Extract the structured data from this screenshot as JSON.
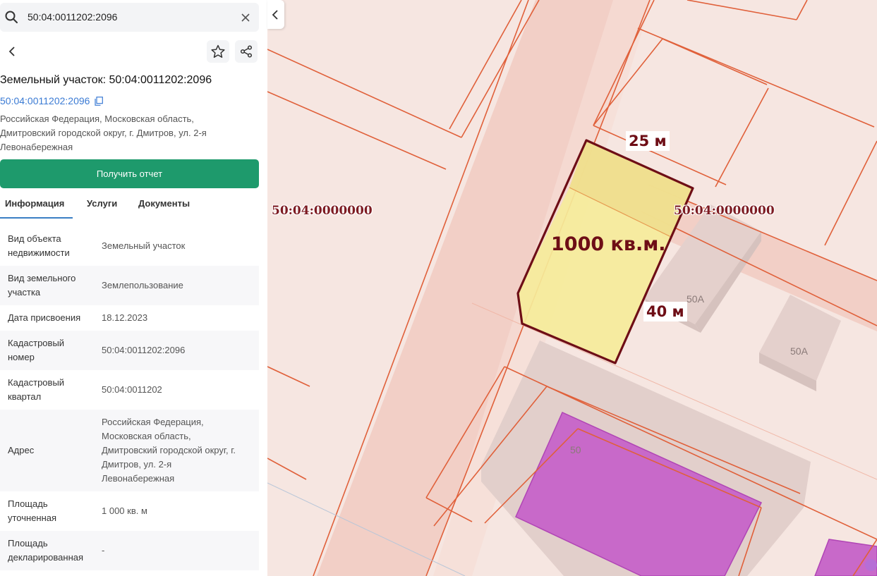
{
  "search": {
    "value": "50:04:0011202:2096"
  },
  "object": {
    "title": "Земельный участок: 50:04:0011202:2096",
    "cadastral_link": "50:04:0011202:2096",
    "address_lines": [
      "Российская Федерация, Московская область,",
      "Дмитровский городской округ, г. Дмитров, ул. 2-я",
      "Левонабережная"
    ]
  },
  "report_button": "Получить отчет",
  "tabs": [
    {
      "label": "Информация",
      "active": true
    },
    {
      "label": "Услуги",
      "active": false
    },
    {
      "label": "Документы",
      "active": false
    }
  ],
  "info_rows": [
    {
      "label_lines": [
        "Вид объекта",
        "недвижимости"
      ],
      "value_lines": [
        "Земельный участок"
      ]
    },
    {
      "label_lines": [
        "Вид земельного",
        "участка"
      ],
      "value_lines": [
        "Землепользование"
      ]
    },
    {
      "label_lines": [
        "Дата присвоения"
      ],
      "value_lines": [
        "18.12.2023"
      ]
    },
    {
      "label_lines": [
        "Кадастровый",
        "номер"
      ],
      "value_lines": [
        "50:04:0011202:2096"
      ]
    },
    {
      "label_lines": [
        "Кадастровый",
        "квартал"
      ],
      "value_lines": [
        "50:04:0011202"
      ]
    },
    {
      "label_lines": [
        "Адрес"
      ],
      "value_lines": [
        "Российская Федерация,",
        "Московская область,",
        "Дмитровский городской округ, г.",
        "Дмитров, ул. 2-я",
        "Левонабережная"
      ]
    },
    {
      "label_lines": [
        "Площадь",
        "уточненная"
      ],
      "value_lines": [
        "1 000 кв. м"
      ]
    },
    {
      "label_lines": [
        "Площадь",
        "декларированная"
      ],
      "value_lines": [
        "-"
      ]
    }
  ],
  "map": {
    "quarter_label_left": "50:04:0000000",
    "quarter_label_right": "50:04:0000000",
    "dimension_top": "25 м",
    "dimension_side": "40 м",
    "area_label": "1000 кв.м.",
    "buildings": [
      "50А",
      "50А",
      "50"
    ]
  },
  "colors": {
    "accent_green": "#1e9a6c",
    "link_blue": "#3b7bd4",
    "parcel_fill": "#f5ec9a",
    "parcel_stroke": "#6e0e16",
    "boundary_orange": "#e0603a",
    "building_purple": "#c860c8"
  }
}
